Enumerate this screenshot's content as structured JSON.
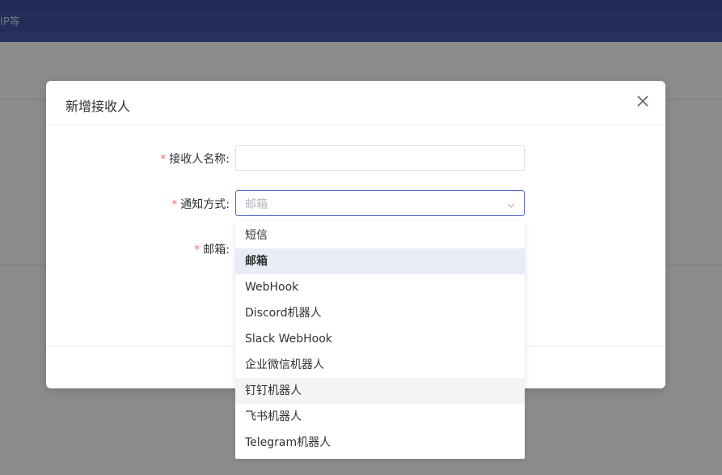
{
  "background": {
    "header_text": "IP等"
  },
  "modal": {
    "title": "新增接收人",
    "close_icon": "close-icon",
    "fields": [
      {
        "label": "接收人名称:",
        "required": true,
        "value": ""
      },
      {
        "label": "通知方式:",
        "required": true,
        "placeholder": "邮箱"
      },
      {
        "label": "邮箱:",
        "required": true
      }
    ],
    "required_mark": "*"
  },
  "dropdown": {
    "selected": "邮箱",
    "hovered": "钉钉机器人",
    "options": [
      "短信",
      "邮箱",
      "WebHook",
      "Discord机器人",
      "Slack WebHook",
      "企业微信机器人",
      "钉钉机器人",
      "飞书机器人",
      "Telegram机器人"
    ]
  },
  "colors": {
    "accent": "#5468c4",
    "required": "#f56c6c",
    "selected_bg": "#e8ecf6",
    "hover_bg": "#f4f4f5"
  }
}
